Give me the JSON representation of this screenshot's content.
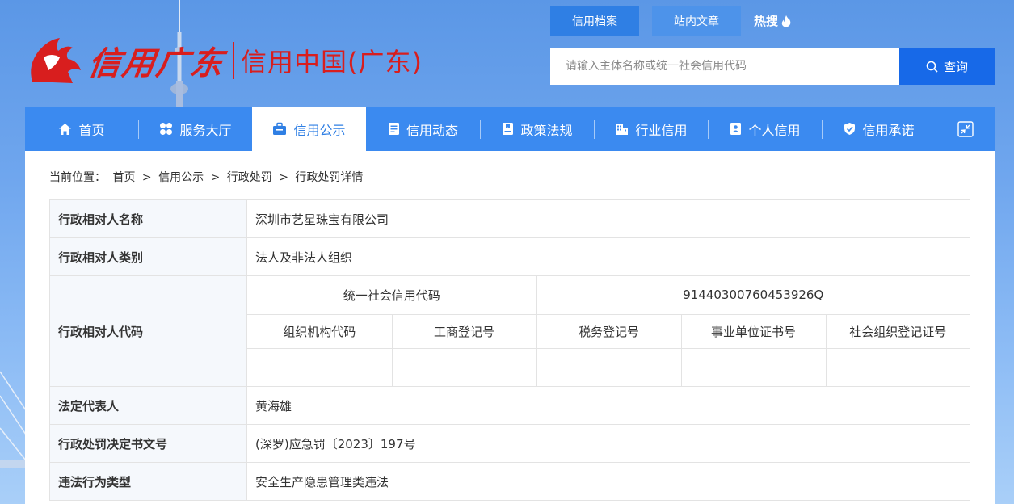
{
  "brand": {
    "script": "信用广东",
    "subtitle": "信用中国(广东)"
  },
  "top_tabs": [
    "信用档案",
    "站内文章"
  ],
  "hot_label": "热搜",
  "search": {
    "placeholder": "请输入主体名称或统一社会信用代码",
    "button_label": "查询"
  },
  "nav": {
    "items": [
      {
        "label": "首页",
        "icon": "home-icon"
      },
      {
        "label": "服务大厅",
        "icon": "grid-icon"
      },
      {
        "label": "信用公示",
        "icon": "briefcase-icon",
        "active": true
      },
      {
        "label": "信用动态",
        "icon": "document-icon"
      },
      {
        "label": "政策法规",
        "icon": "book-icon"
      },
      {
        "label": "行业信用",
        "icon": "building-icon"
      },
      {
        "label": "个人信用",
        "icon": "id-card-icon"
      },
      {
        "label": "信用承诺",
        "icon": "shield-check-icon"
      }
    ],
    "expand_icon": "shrink-icon"
  },
  "breadcrumb": {
    "prefix": "当前位置：",
    "items": [
      "首页",
      "信用公示",
      "行政处罚",
      "行政处罚详情"
    ],
    "sep": ">"
  },
  "detail": {
    "name_label": "行政相对人名称",
    "name_value": "深圳市艺星珠宝有限公司",
    "type_label": "行政相对人类别",
    "type_value": "法人及非法人组织",
    "code_label": "行政相对人代码",
    "code_headers": {
      "uscc": "统一社会信用代码",
      "uscc_value": "91440300760453926Q",
      "org_code": "组织机构代码",
      "biz_reg": "工商登记号",
      "tax_reg": "税务登记号",
      "inst_cert": "事业单位证书号",
      "social_org": "社会组织登记证号"
    },
    "code_values": {
      "org_code": "",
      "biz_reg": "",
      "tax_reg": "",
      "inst_cert": "",
      "social_org": ""
    },
    "legal_rep_label": "法定代表人",
    "legal_rep_value": "黄海雄",
    "doc_no_label": "行政处罚决定书文号",
    "doc_no_value": "(深罗)应急罚〔2023〕197号",
    "violation_label": "违法行为类型",
    "violation_value": "安全生产隐患管理类违法"
  },
  "colors": {
    "nav_bg": "#3b8af0",
    "accent": "#2f7fe4",
    "search_btn": "#1769e8",
    "brand_red": "#d81e1e"
  }
}
